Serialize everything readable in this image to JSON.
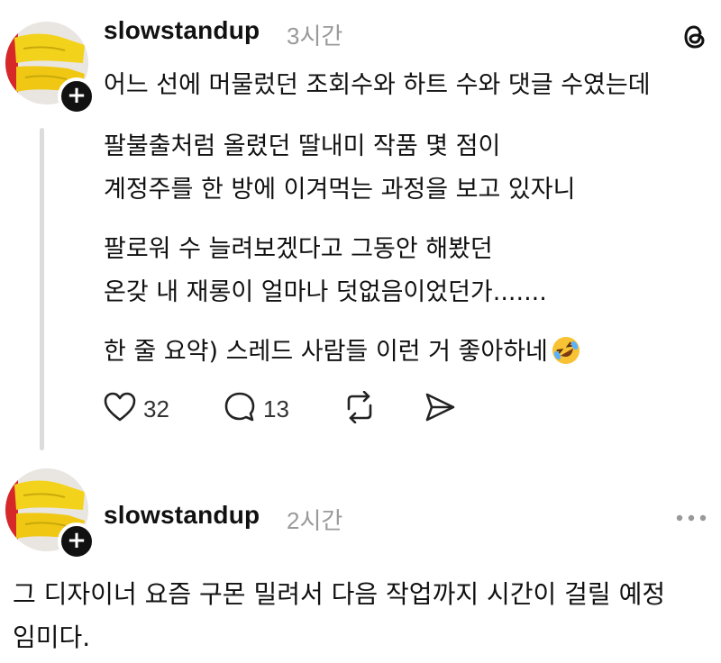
{
  "posts": [
    {
      "username": "slowstandup",
      "time": "3시간",
      "lines": [
        "어느 선에 머물렀던 조회수와 하트 수와 댓글 수였는데",
        "팔불출처럼 올렸던 딸내미 작품 몇 점이",
        "계정주를 한 방에 이겨먹는 과정을 보고 있자니",
        "팔로워 수 늘려보겠다고 그동안 해봤던",
        "온갖 내 재롱이 얼마나 덧없음이었던가.......",
        "한 줄 요약) 스레드 사람들 이런 거 좋아하네"
      ],
      "emoji": "rolling-on-floor-laughing-emoji",
      "likes": "32",
      "comments": "13"
    },
    {
      "username": "slowstandup",
      "time": "2시간",
      "lines": [
        "그 디자이너 요즘 구몬 밀려서 다음 작업까지 시간이 걸릴 예정",
        "임미다."
      ]
    }
  ],
  "icons": {
    "app_logo": "threads-logo-icon",
    "like": "heart-icon",
    "comment": "comment-icon",
    "repost": "repost-icon",
    "share": "send-icon",
    "more": "more-dots-icon",
    "follow": "plus-icon"
  },
  "colors": {
    "text": "#111111",
    "secondary": "#9a9a9a",
    "avatar_yellow": "#f3d21c",
    "avatar_red": "#d62828"
  }
}
